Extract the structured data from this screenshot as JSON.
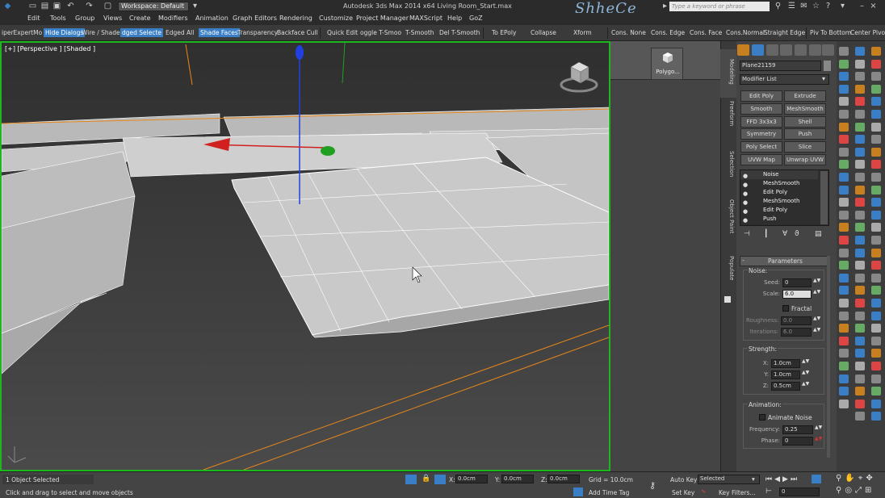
{
  "titlebar": {
    "workspace": "Workspace: Default",
    "app_title": "Autodesk 3ds Max  2014 x64     Living Room_Start.max",
    "logo_text": "ShheCe",
    "search_placeholder": "Type a keyword or phrase"
  },
  "menu": [
    "Edit",
    "Tools",
    "Group",
    "Views",
    "Create",
    "Modifiers",
    "Animation",
    "Graph Editors",
    "Rendering",
    "Customize",
    "Project Manager",
    "MAXScript",
    "Help",
    "GoZ"
  ],
  "ribbon": {
    "items": [
      "iperExpertMo",
      "Hide Dialogs",
      "Wire / Shaded",
      "dged Selecte",
      "Edged All",
      "Shade Faces",
      "Transparency",
      "Backface Cull",
      "Quick Edit",
      "oggle T-Smoo",
      "T-Smooth",
      "Del T-Smooth",
      "To  EPoly",
      "Collapse",
      "Xform",
      "Cons. None",
      "Cons. Edge",
      "Cons. Face",
      "Cons.Normal",
      "Straight Edge",
      "Piv To Bottom",
      "Center Pivot"
    ]
  },
  "viewport": {
    "label": "[+] [Perspective ] [Shaded ]"
  },
  "command_panel": {
    "shelf_item": "Polygo...",
    "tabs": [
      "Modeling",
      "Freeform",
      "Selection",
      "Object Paint",
      "Populate"
    ],
    "object_name": "Plane21159",
    "modifier_list_label": "Modifier List",
    "modifier_buttons": [
      "Edit Poly",
      "Extrude",
      "Smooth",
      "MeshSmooth",
      "FFD 3x3x3",
      "Shell",
      "Symmetry",
      "Push",
      "Poly Select",
      "Slice",
      "UVW Map",
      "Unwrap UVW"
    ],
    "stack": [
      "Noise",
      "MeshSmooth",
      "Edit Poly",
      "MeshSmooth",
      "Edit Poly",
      "Push"
    ],
    "parameters_title": "Parameters",
    "noise_group": "Noise:",
    "seed_label": "Seed:",
    "seed_value": "0",
    "scale_label": "Scale:",
    "scale_value": "6.0",
    "fractal_label": "Fractal",
    "roughness_label": "Roughness:",
    "roughness_value": "0.0",
    "iterations_label": "Iterations:",
    "iterations_value": "6.0",
    "strength_group": "Strength:",
    "x_label": "X:",
    "x_value": "1.0cm",
    "y_label": "Y:",
    "y_value": "1.0cm",
    "z_label": "Z:",
    "z_value": "0.5cm",
    "animation_group": "Animation:",
    "animate_noise_label": "Animate Noise",
    "frequency_label": "Frequency:",
    "frequency_value": "0.25",
    "phase_label": "Phase:",
    "phase_value": "0"
  },
  "status": {
    "selection": "1 Object Selected",
    "prompt": "Click and drag to select and move objects",
    "x_label": "X:",
    "x_value": "0.0cm",
    "y_label": "Y:",
    "y_value": "0.0cm",
    "z_label": "Z:",
    "z_value": "0.0cm",
    "grid": "Grid = 10.0cm",
    "add_time_tag": "Add Time Tag",
    "auto_key": "Auto Key",
    "set_key": "Set Key",
    "selected_dropdown": "Selected",
    "key_filters": "Key Filters...",
    "frame_value": "0"
  },
  "colors": {
    "viewport_border": "#1fb71f",
    "highlight": "#3a7fc6",
    "axis_x": "#d02020",
    "axis_y": "#20a020",
    "axis_z": "#2040e0"
  }
}
